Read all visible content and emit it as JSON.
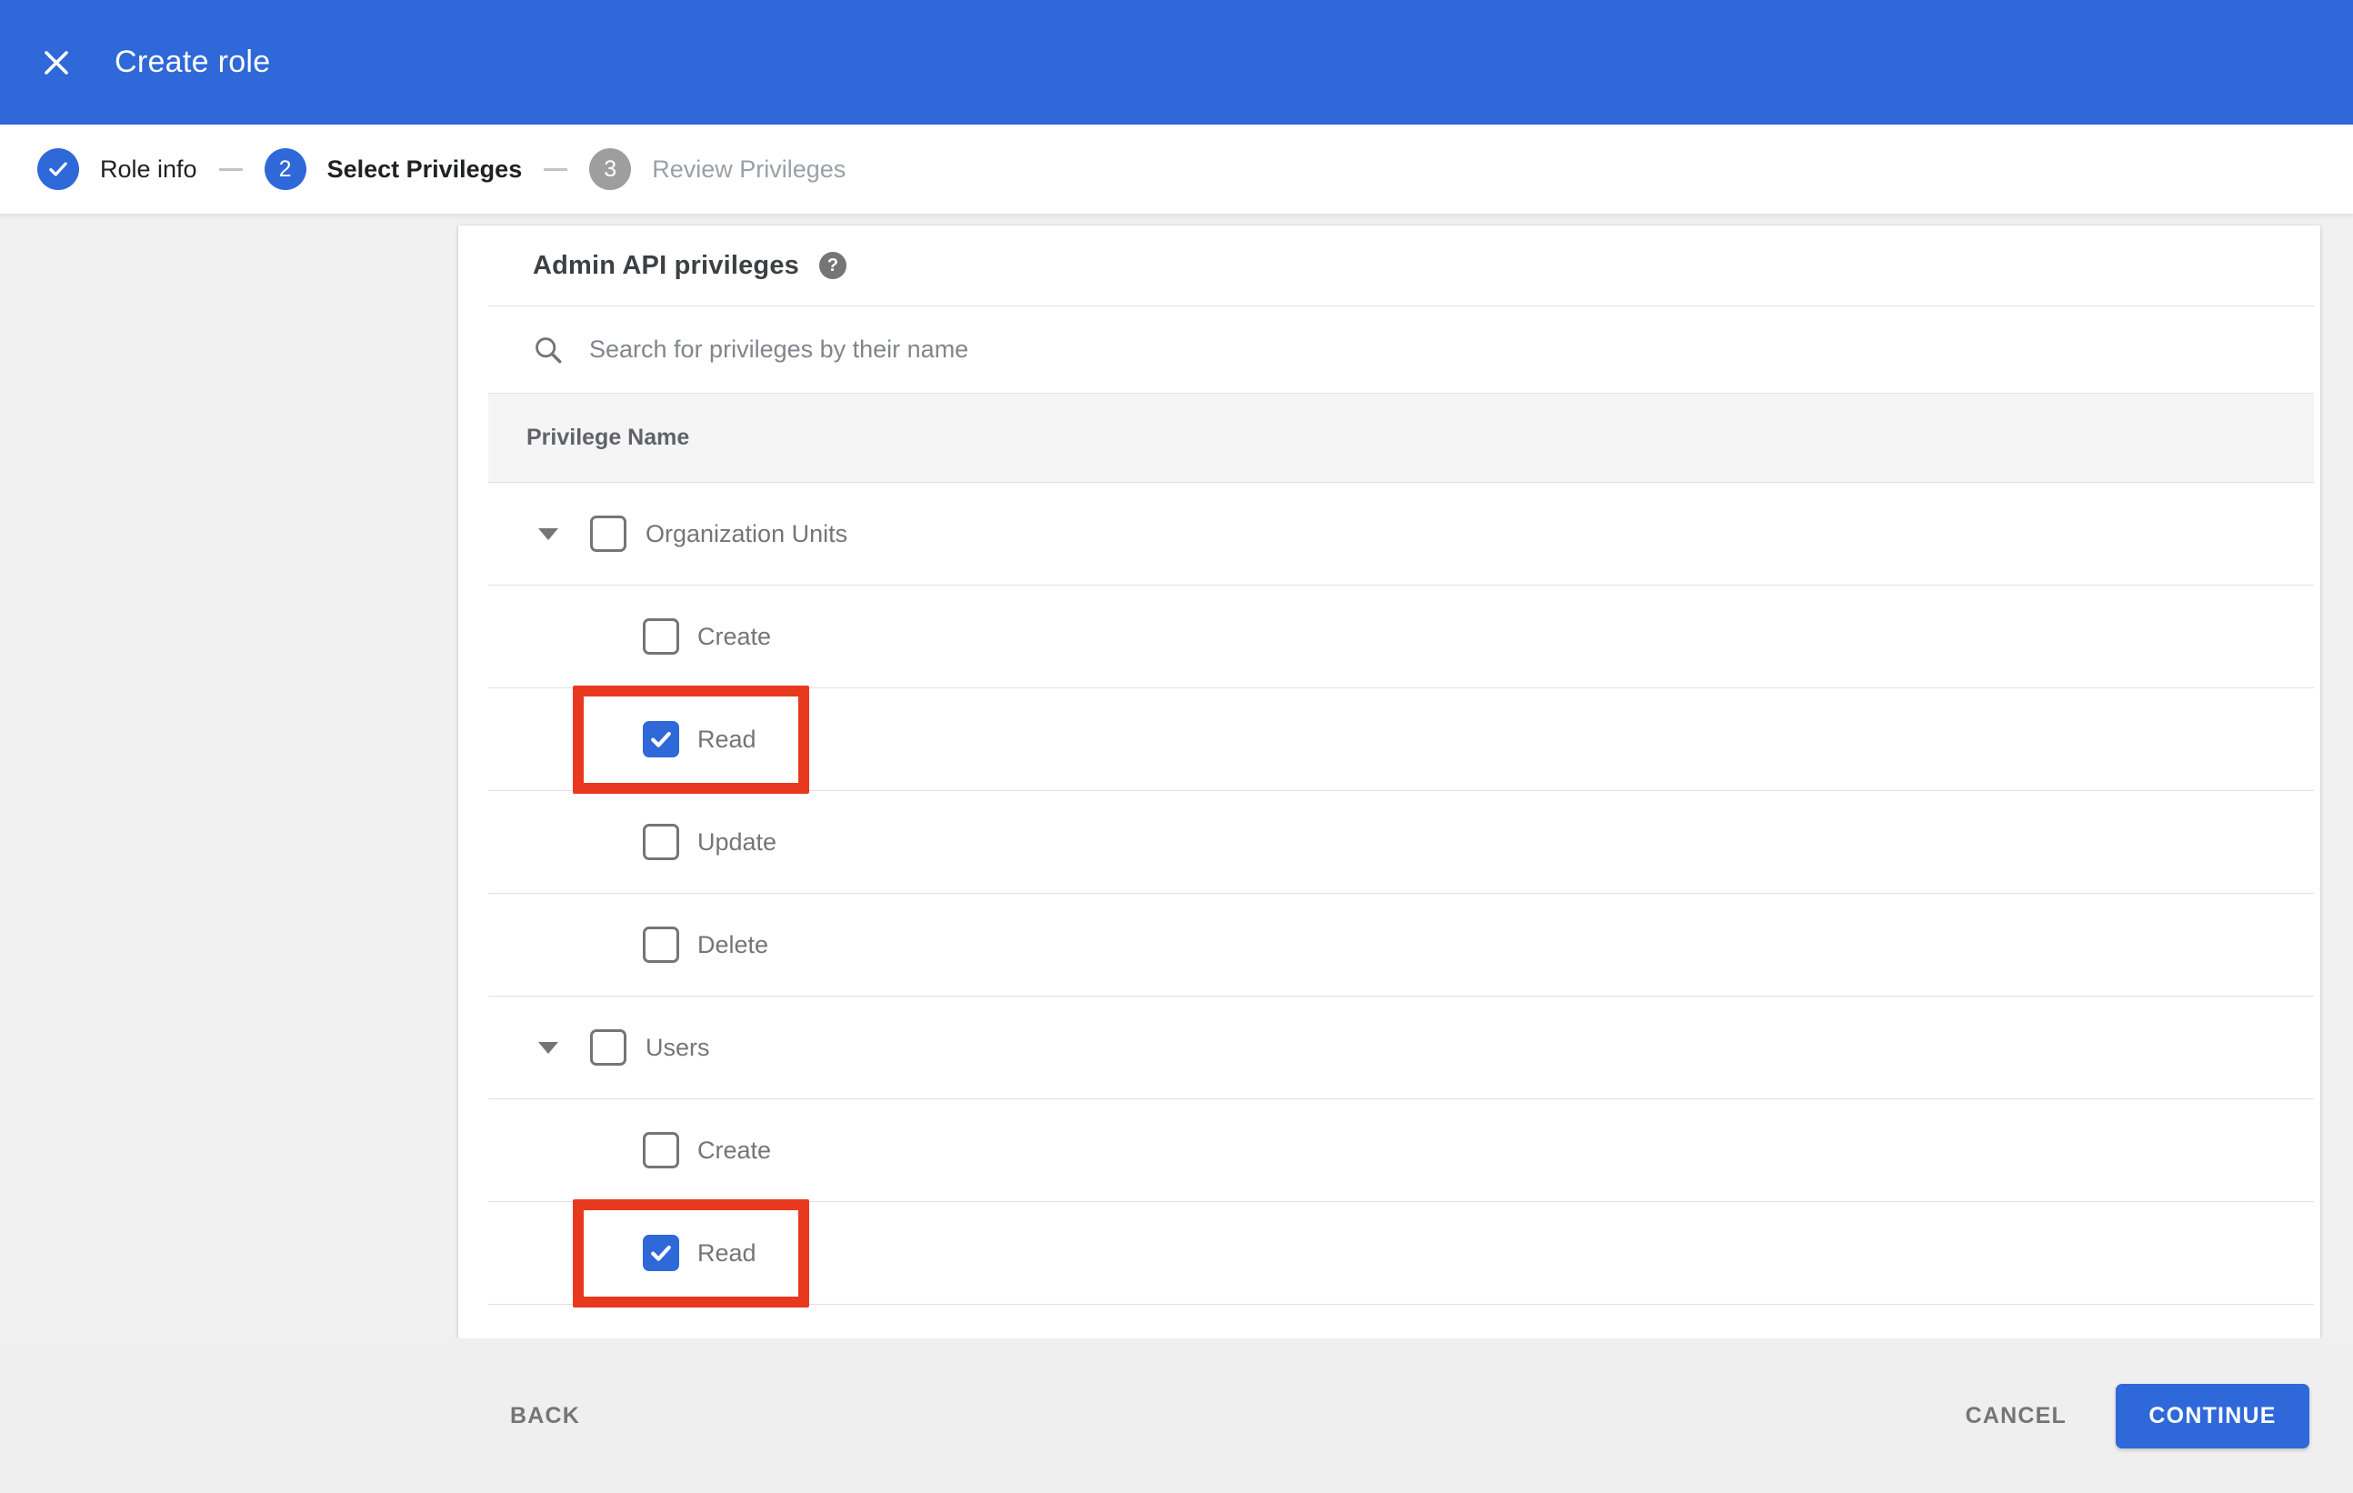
{
  "header": {
    "title": "Create role",
    "close_icon": "x-close"
  },
  "stepper": {
    "steps": [
      {
        "label": "Role info",
        "state": "completed",
        "icon": "checkmark"
      },
      {
        "number": "2",
        "label": "Select Privileges",
        "state": "active"
      },
      {
        "number": "3",
        "label": "Review Privileges",
        "state": "upcoming"
      }
    ]
  },
  "panel": {
    "title": "Admin API privileges",
    "help_icon": "?",
    "search": {
      "placeholder": "Search for privileges by their name",
      "value": ""
    },
    "table": {
      "header": "Privilege Name",
      "groups": [
        {
          "label": "Organization Units",
          "checked": false,
          "expanded": true,
          "children": [
            {
              "label": "Create",
              "checked": false,
              "highlighted": false
            },
            {
              "label": "Read",
              "checked": true,
              "highlighted": true
            },
            {
              "label": "Update",
              "checked": false,
              "highlighted": false
            },
            {
              "label": "Delete",
              "checked": false,
              "highlighted": false
            }
          ]
        },
        {
          "label": "Users",
          "checked": false,
          "expanded": true,
          "children": [
            {
              "label": "Create",
              "checked": false,
              "highlighted": false
            },
            {
              "label": "Read",
              "checked": true,
              "highlighted": true
            }
          ]
        }
      ]
    }
  },
  "footer": {
    "back_label": "BACK",
    "cancel_label": "CANCEL",
    "continue_label": "CONTINUE"
  },
  "colors": {
    "accent": "#2e68d9",
    "highlight_box": "#e8391f",
    "page_background": "#f1f1f1",
    "footer_background": "#efefef",
    "table_header_background": "#f5f5f5",
    "divider": "#e0e0e0",
    "row_text": "#757575"
  }
}
